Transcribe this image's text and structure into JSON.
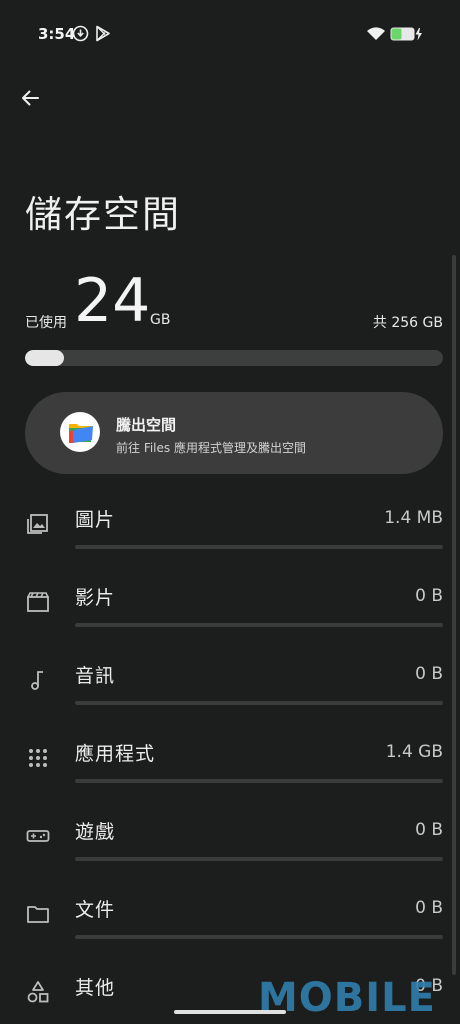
{
  "status_bar": {
    "time": "3:54"
  },
  "header": {
    "title": "儲存空間"
  },
  "usage": {
    "used_label": "已使用",
    "used_value": "24",
    "used_unit": "GB",
    "total_label": "共 256 GB",
    "used_fraction": 0.094
  },
  "free_up_card": {
    "title": "騰出空間",
    "subtitle": "前往 Files 應用程式管理及騰出空間"
  },
  "categories": [
    {
      "label": "圖片",
      "size": "1.4 MB",
      "icon": "image-icon"
    },
    {
      "label": "影片",
      "size": "0 B",
      "icon": "movie-icon"
    },
    {
      "label": "音訊",
      "size": "0 B",
      "icon": "music-note-icon"
    },
    {
      "label": "應用程式",
      "size": "1.4 GB",
      "icon": "apps-grid-icon"
    },
    {
      "label": "遊戲",
      "size": "0 B",
      "icon": "gamepad-icon"
    },
    {
      "label": "文件",
      "size": "0 B",
      "icon": "folder-icon"
    },
    {
      "label": "其他",
      "size": "0 B",
      "icon": "shapes-icon"
    }
  ],
  "watermark": "MOBILE",
  "colors": {
    "background": "#1c1d1d",
    "card": "#3b3c3b",
    "progress_fill": "#e6e6e6",
    "battery": "#6bd66b",
    "watermark": "#2f7fae"
  }
}
